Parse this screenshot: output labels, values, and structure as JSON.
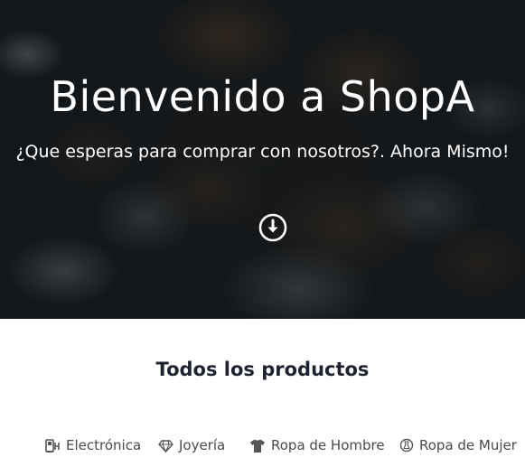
{
  "hero": {
    "title": "Bienvenido a ShopA",
    "subtitle": "¿Que esperas para comprar con nosotros?. Ahora Mismo!",
    "scroll_icon": "arrow-circle-down-icon"
  },
  "products": {
    "title": "Todos los productos",
    "categories": [
      {
        "label": "Electrónica",
        "icon": "electronics-icon"
      },
      {
        "label": "Joyería",
        "icon": "diamond-icon"
      },
      {
        "label": "Ropa de Hombre",
        "icon": "tshirt-icon"
      },
      {
        "label": "Ropa de Mujer",
        "icon": "dress-icon"
      }
    ]
  },
  "colors": {
    "title_text": "#1f2330",
    "category_text": "#4a4a4a",
    "hero_text": "#ffffff"
  }
}
